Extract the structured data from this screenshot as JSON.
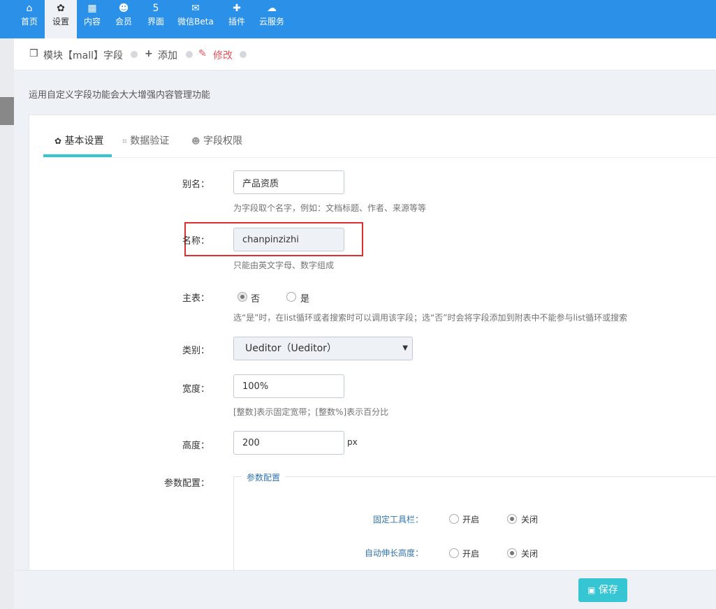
{
  "nav": {
    "items": [
      {
        "icon": "home-icon",
        "glyph": "⌂",
        "label": "首页"
      },
      {
        "icon": "gear-icon",
        "glyph": "✿",
        "label": "设置"
      },
      {
        "icon": "grid-icon",
        "glyph": "▦",
        "label": "内容"
      },
      {
        "icon": "user-icon",
        "glyph": "☻",
        "label": "会员"
      },
      {
        "icon": "html5-icon",
        "glyph": "5",
        "label": "界面"
      },
      {
        "icon": "wechat-icon",
        "glyph": "✉",
        "label": "微信Beta"
      },
      {
        "icon": "puzzle-icon",
        "glyph": "✚",
        "label": "插件"
      },
      {
        "icon": "cloud-icon",
        "glyph": "☁",
        "label": "云服务"
      }
    ],
    "active_index": 1
  },
  "breadcrumb": {
    "module": "模块【mall】字段",
    "add": "添加",
    "edit": "修改"
  },
  "description": "运用自定义字段功能会大大增强内容管理功能",
  "tabs": [
    {
      "icon": "gear-icon",
      "label": "基本设置"
    },
    {
      "icon": "crop-icon",
      "label": "数据验证"
    },
    {
      "icon": "user-icon",
      "label": "字段权限"
    }
  ],
  "form": {
    "alias": {
      "label": "别名：",
      "value": "产品资质",
      "help": "为字段取个名字，例如：文档标题、作者、来源等等"
    },
    "name": {
      "label": "名称：",
      "value": "chanpinzizhi",
      "help": "只能由英文字母、数字组成"
    },
    "main_table": {
      "label": "主表：",
      "options": [
        "否",
        "是"
      ],
      "selected": "否",
      "help": "选“是”时，在list循环或者搜索时可以调用该字段；选“否”时会将字段添加到附表中不能参与list循环或搜索"
    },
    "type": {
      "label": "类别：",
      "value": "Ueditor（Ueditor）"
    },
    "width": {
      "label": "宽度：",
      "value": "100%",
      "help": "[整数]表示固定宽带；[整数%]表示百分比"
    },
    "height": {
      "label": "高度：",
      "value": "200",
      "unit": "px"
    },
    "params": {
      "label": "参数配置：",
      "legend": "参数配置",
      "fixed_toolbar": {
        "label": "固定工具栏：",
        "options": [
          "开启",
          "关闭"
        ],
        "selected": "关闭"
      },
      "auto_height": {
        "label": "自动伸长高度：",
        "options": [
          "开启",
          "关闭"
        ],
        "selected": "关闭"
      }
    }
  },
  "save_button": "保存"
}
